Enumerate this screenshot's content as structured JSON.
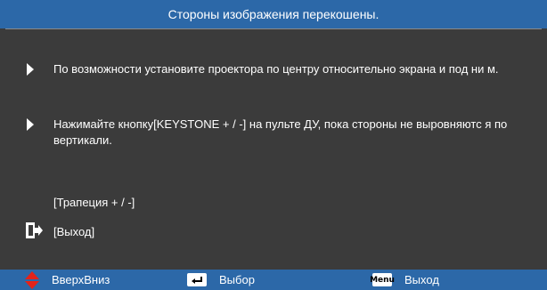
{
  "title": "Стороны изображения перекошены.",
  "bullets": [
    "По возможности установите проектора по центру относительно экрана и под ни м.",
    "Нажимайте кнопку[KEYSTONE + / -] на пульте ДУ, пока стороны не выровняютс я по вертикали."
  ],
  "options": {
    "keystone": "[Трапеция + / -]",
    "exit": "[Выход]"
  },
  "footer": {
    "updown": "ВверхВниз",
    "select": "Выбор",
    "exit": "Выход",
    "menu_key": "Menu"
  },
  "colors": {
    "bar_blue": "#2c68a8",
    "panel_gray": "#3b3b3b",
    "updown_red": "#e2231a"
  },
  "icons": [
    "right-arrow-bullet-icon",
    "exit-door-icon",
    "up-down-arrows-icon",
    "enter-key-icon",
    "menu-key-icon"
  ]
}
